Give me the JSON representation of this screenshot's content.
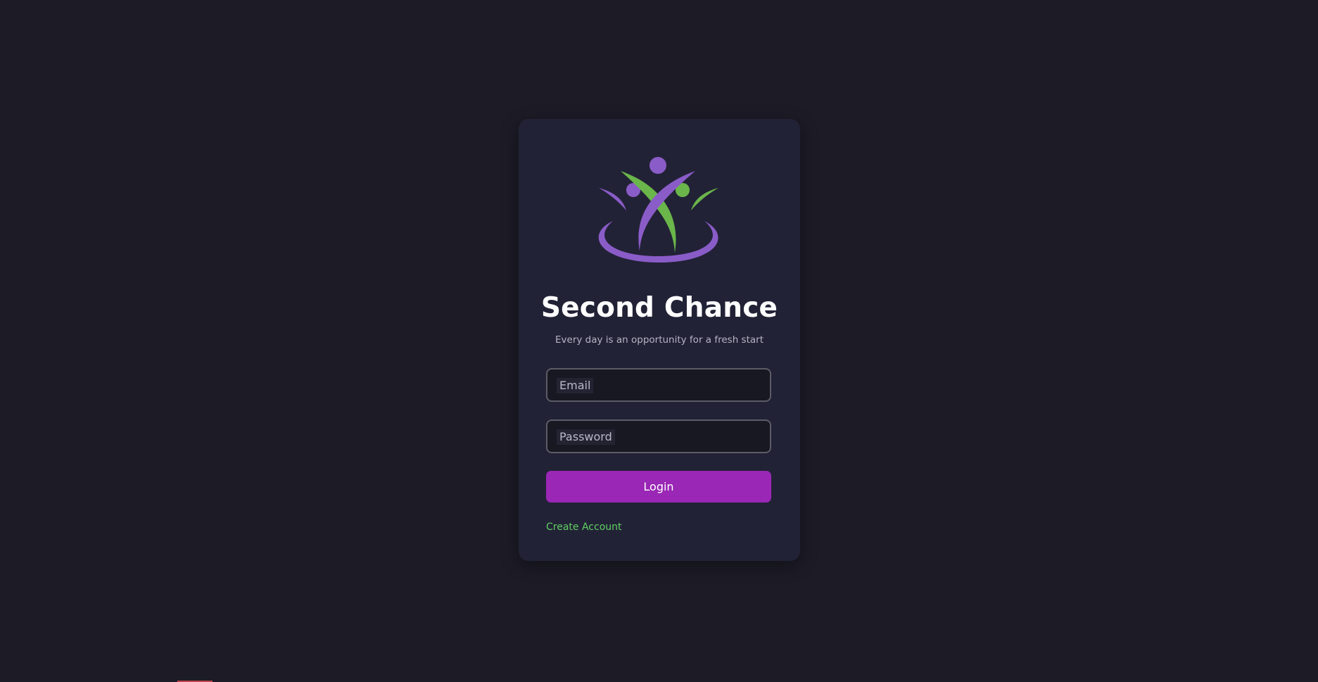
{
  "app": {
    "title": "Second Chance",
    "tagline": "Every day is an opportunity for a fresh start"
  },
  "form": {
    "email": {
      "placeholder": "Email",
      "value": ""
    },
    "password": {
      "placeholder": "Password",
      "value": ""
    },
    "login_label": "Login",
    "create_account_label": "Create Account"
  },
  "colors": {
    "background": "#1c1b26",
    "card": "#222236",
    "accent_purple": "#9a27b5",
    "logo_purple": "#8a5cc8",
    "logo_green": "#6ab64a",
    "link_green": "#5fcf62"
  },
  "icons": {
    "logo": "people-embrace-logo"
  }
}
